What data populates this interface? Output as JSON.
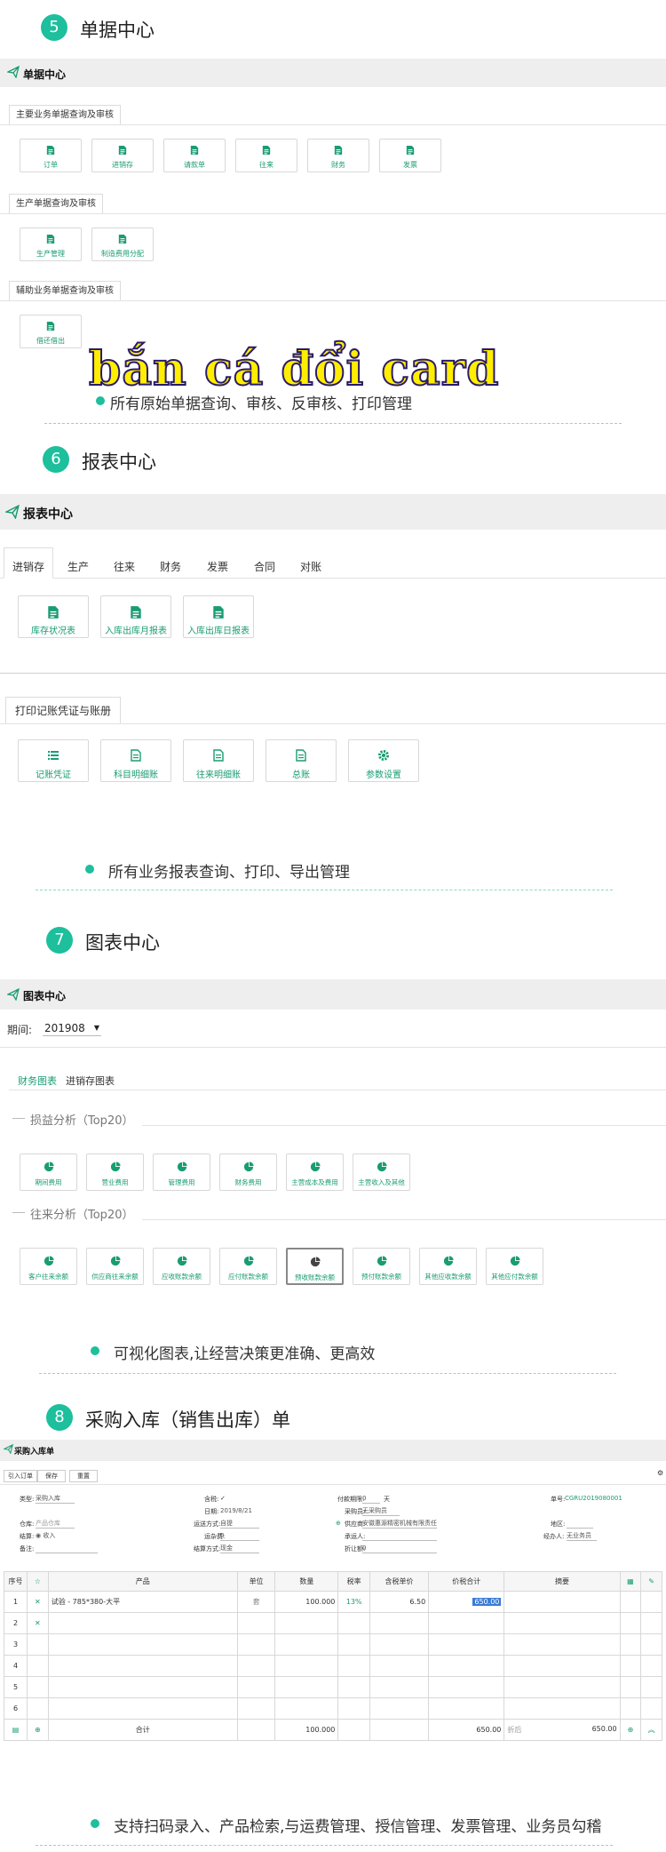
{
  "accent": "#1dbf9c",
  "sections": {
    "s5": {
      "num": "5",
      "title": "单据中心"
    },
    "s6": {
      "num": "6",
      "title": "报表中心"
    },
    "s7": {
      "num": "7",
      "title": "图表中心"
    },
    "s8": {
      "num": "8",
      "title": "采购入库（销售出库）单"
    }
  },
  "doc_center": {
    "bar_title": "单据中心",
    "group1": {
      "label": "主要业务单据查询及审核",
      "tiles": [
        "订单",
        "进销存",
        "请款单",
        "往来",
        "财务",
        "发票"
      ]
    },
    "group2": {
      "label": "生产单据查询及审核",
      "tiles": [
        "生产管理",
        "制造费用分配"
      ]
    },
    "group3": {
      "label": "辅助业务单据查询及审核",
      "tiles": [
        "借还借出"
      ]
    }
  },
  "banner": {
    "text": "bắn cá đổi card"
  },
  "bullet5": "所有原始单据查询、审核、反审核、打印管理",
  "report_center": {
    "bar_title": "报表中心",
    "tabs": [
      "进销存",
      "生产",
      "往来",
      "财务",
      "发票",
      "合同",
      "对账"
    ],
    "tiles": [
      "库存状况表",
      "入库出库月报表",
      "入库出库日报表"
    ],
    "print_label": "打印记账凭证与账册",
    "print_tiles": [
      "记账凭证",
      "科目明细账",
      "往来明细账",
      "总账",
      "参数设置"
    ]
  },
  "bullet6": "所有业务报表查询、打印、导出管理",
  "chart_center": {
    "bar_title": "图表中心",
    "period_label": "期间:",
    "period_value": "201908",
    "tabs": [
      "财务图表",
      "进销存图表"
    ],
    "g1_label": "损益分析（Top20）",
    "g1_tiles": [
      "期间费用",
      "营业费用",
      "管理费用",
      "财务费用",
      "主营成本及费用",
      "主营收入及其他"
    ],
    "g2_label": "往来分析（Top20）",
    "g2_tiles": [
      "客户往来余额",
      "供应商往来余额",
      "应收账款余额",
      "应付账款余额",
      "预收账款余额",
      "预付账款余额",
      "其他应收款余额",
      "其他应付款余额"
    ]
  },
  "bullet7": "可视化图表,让经营决策更准确、更高效",
  "purchase": {
    "bar_title": "采购入库单",
    "toolbar": [
      "引入订单",
      "保存",
      "重置"
    ],
    "form": {
      "type_label": "类型:",
      "type_value": "采购入库",
      "store_label": "仓库:",
      "store_value": "产品仓库",
      "mode_label": "结算:",
      "mode_value": "收入",
      "note_label": "备注:",
      "tax_label": "含税:",
      "tax_value": "✓",
      "date_label": "日期:",
      "date_value": "2019/8/21",
      "ship_label": "运送方式:",
      "ship_value": "自提",
      "fee_label": "运杂费:",
      "fee_value": "0",
      "settle_label": "结算方式:",
      "settle_value": "现金",
      "pay_label": "付款期限:",
      "pay_value": "0",
      "pay_unit": "天",
      "purchaser_label": "采购员:",
      "purchaser_value": "无采购员",
      "supplier_label": "供应商:",
      "supplier_value": "安徽惠源精密机械有限责任公司",
      "handler_label": "承运人:",
      "disc_label": "折让额:",
      "disc_value": "0",
      "no_label": "单号:",
      "no_value": "CGRU2019080001",
      "region_label": "地区:",
      "region_value": "",
      "salesman_label": "经办人:",
      "salesman_value": "无业务员"
    },
    "columns": [
      "序号",
      "",
      "产品",
      "单位",
      "数量",
      "税率",
      "含税单价",
      "价税合计",
      "摘要",
      "",
      ""
    ],
    "rows": [
      {
        "no": "1",
        "product": "试验 - 785*380-大平",
        "unit": "套",
        "qty": "100.000",
        "tax": "13%",
        "price": "6.50",
        "total": "650.00"
      },
      {
        "no": "2"
      },
      {
        "no": "3"
      },
      {
        "no": "4"
      },
      {
        "no": "5"
      },
      {
        "no": "6"
      }
    ],
    "footer": {
      "label": "合计",
      "qty": "100.000",
      "total": "650.00",
      "disc_label": "折后",
      "disc_total": "650.00"
    }
  },
  "bullet8": "支持扫码录入、产品检索,与运费管理、授信管理、发票管理、业务员勾稽"
}
